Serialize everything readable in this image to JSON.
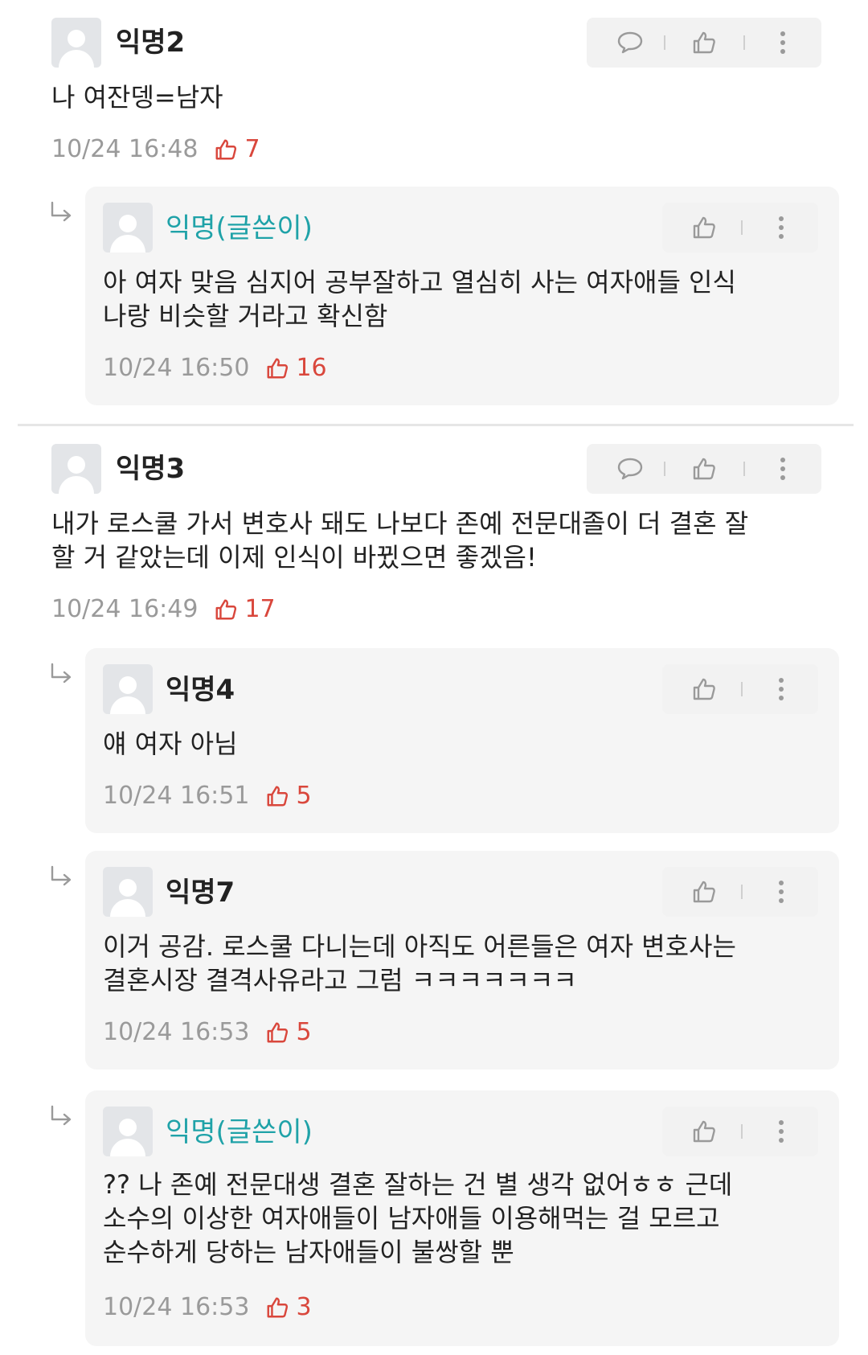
{
  "comments": [
    {
      "author": "익명2",
      "text": "나 여잔뎅=남자",
      "time": "10/24 16:48",
      "likes": "7",
      "is_op": false,
      "replies": [
        {
          "author": "익명(글쓴이)",
          "text": "아 여자 맞음 심지어 공부잘하고 열심히 사는 여자애들 인식\n나랑 비슷할 거라고 확신함",
          "time": "10/24 16:50",
          "likes": "16",
          "is_op": true
        }
      ]
    },
    {
      "author": "익명3",
      "text": "내가 로스쿨 가서 변호사 돼도 나보다 존예 전문대졸이 더 결혼 잘\n할 거 같았는데 이제 인식이 바뀠으면 좋겠음!",
      "time": "10/24 16:49",
      "likes": "17",
      "is_op": false,
      "replies": [
        {
          "author": "익명4",
          "text": "얘 여자 아님",
          "time": "10/24 16:51",
          "likes": "5",
          "is_op": false
        },
        {
          "author": "익명7",
          "text": "이거 공감. 로스쿨 다니는데 아직도 어른들은 여자 변호사는\n결혼시장 결격사유라고 그럼 ㅋㅋㅋㅋㅋㅋㅋ",
          "time": "10/24 16:53",
          "likes": "5",
          "is_op": false
        },
        {
          "author": "익명(글쓴이)",
          "text": "?? 나 존예 전문대생 결혼 잘하는 건 별 생각 없어ㅎㅎ 근데\n소수의 이상한 여자애들이 남자애들 이용해먹는 걸 모르고\n순수하게 당하는 남자애들이 불쌍할 뿐",
          "time": "10/24 16:53",
          "likes": "3",
          "is_op": true
        }
      ]
    }
  ],
  "icons": {
    "reply": "speech-bubble-icon",
    "like": "thumbs-up-icon",
    "more": "vertical-dots-icon",
    "reply_indicator": "reply-arrow-icon"
  },
  "colors": {
    "op_name": "#1fa2a8",
    "like_red": "#d9473c",
    "meta_gray": "#9a9a9a",
    "reply_bg": "#f5f5f5",
    "action_bg": "#f2f2f2"
  }
}
